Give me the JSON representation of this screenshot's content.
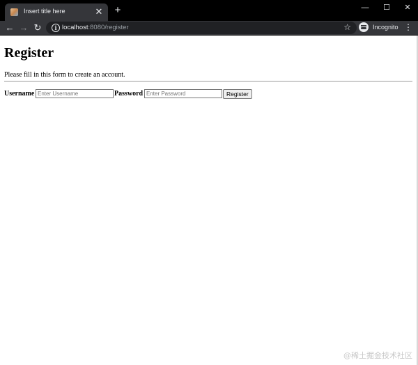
{
  "browser": {
    "tab_title": "Insert title here",
    "tab_close": "✕",
    "new_tab": "+",
    "window_minimize": "—",
    "window_maximize": "☐",
    "window_close": "✕",
    "url_host": "localhost",
    "url_rest": ":8080/register",
    "incognito_label": "Incognito",
    "icons": {
      "back": "arrow-left-icon",
      "forward": "arrow-right-icon",
      "reload": "reload-icon",
      "info": "info-icon",
      "star": "star-icon",
      "menu": "kebab-menu-icon"
    }
  },
  "page": {
    "title": "Register",
    "intro": "Please fill in this form to create an account.",
    "form": {
      "username_label": "Username",
      "username_placeholder": "Enter Username",
      "password_label": "Password",
      "password_placeholder": "Enter Password",
      "submit_label": "Register"
    }
  },
  "watermark": "@稀土掘金技术社区"
}
